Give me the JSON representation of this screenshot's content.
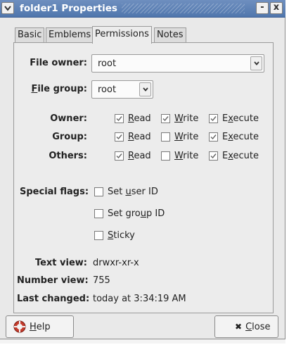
{
  "window": {
    "title": "folder1 Properties",
    "minimize": "-",
    "close": "x"
  },
  "tabs": [
    "Basic",
    "Emblems",
    "Permissions",
    "Notes"
  ],
  "owner": {
    "file_owner_prefix": "File owner:",
    "file_owner_value": "root",
    "file_group_underlined": "F",
    "file_group_rest": "ile group:",
    "file_group_value": "root"
  },
  "permissions": {
    "rows": [
      {
        "label": "Owner:",
        "read": true,
        "write": true,
        "execute": true
      },
      {
        "label": "Group:",
        "read": true,
        "write": false,
        "execute": true
      },
      {
        "label": "Others:",
        "read": true,
        "write": false,
        "execute": true
      }
    ],
    "read_u": "R",
    "read_rest": "ead",
    "write_u": "W",
    "write_rest": "rite",
    "exec_pre": "E",
    "exec_u": "x",
    "exec_rest": "ecute"
  },
  "special": {
    "label": "Special flags:",
    "set_uid_pre": "Set ",
    "set_uid_u": "u",
    "set_uid_rest": "ser ID",
    "set_uid_checked": false,
    "set_gid_pre": "Set gro",
    "set_gid_u": "u",
    "set_gid_rest": "p ID",
    "set_gid_checked": false,
    "sticky_u": "S",
    "sticky_rest": "ticky",
    "sticky_checked": false
  },
  "info": {
    "text_view_label": "Text view:",
    "text_view": "drwxr-xr-x",
    "number_view_label": "Number view:",
    "number_view": "755",
    "last_changed_label": "Last changed:",
    "last_changed": "today at 3:34:19 AM"
  },
  "buttons": {
    "help_u": "H",
    "help_rest": "elp",
    "close_icon": "✖",
    "close_u": "C",
    "close_rest": "lose"
  }
}
